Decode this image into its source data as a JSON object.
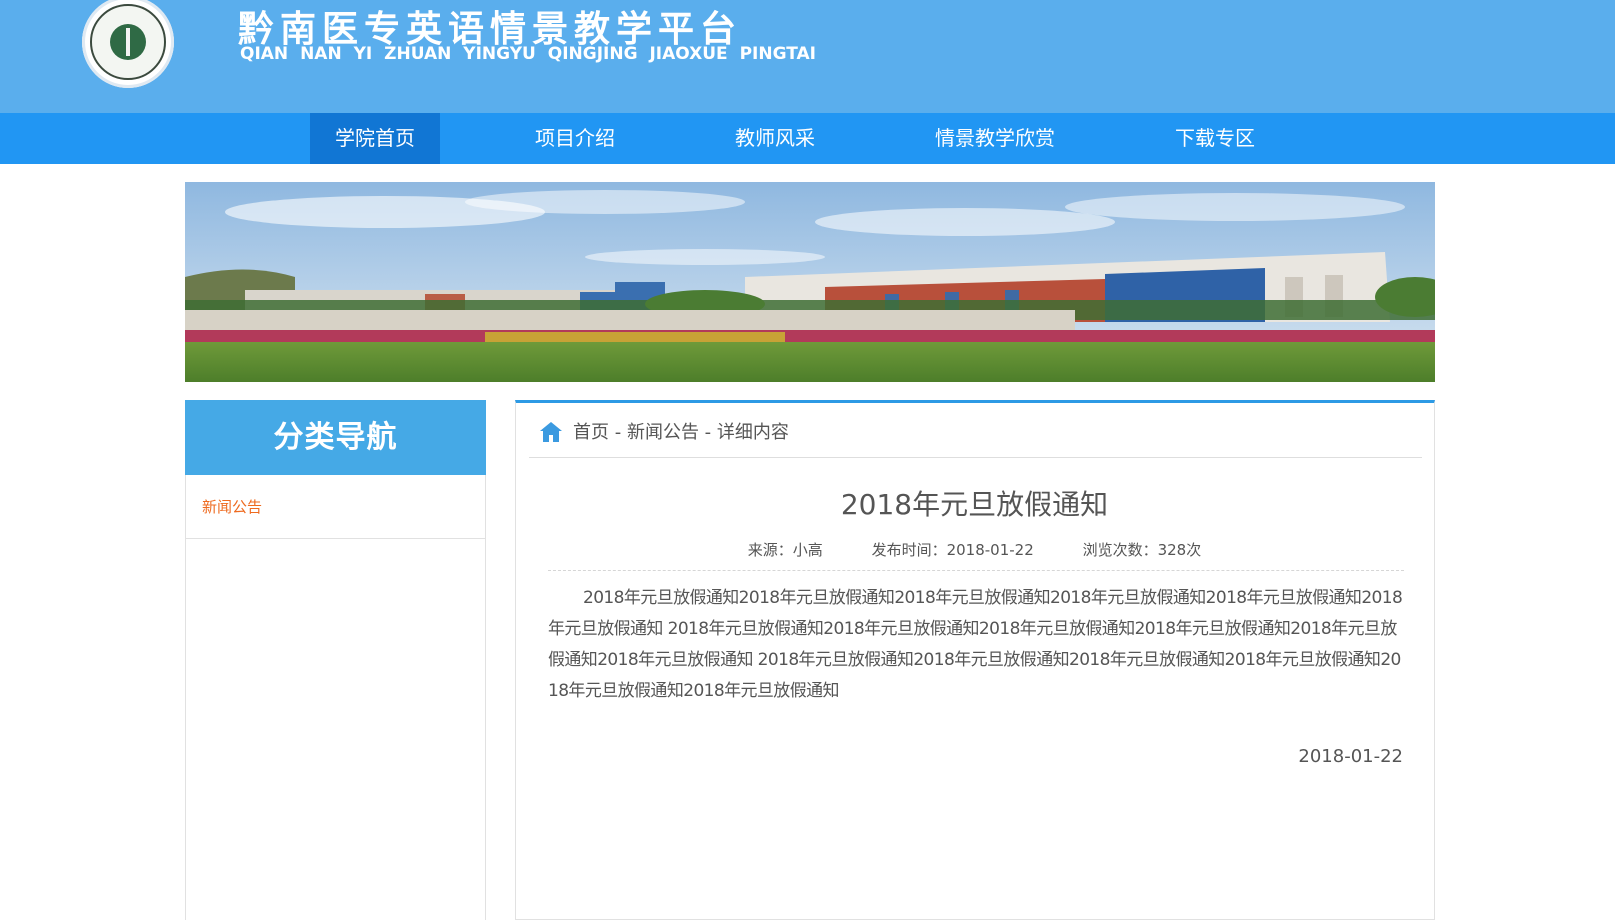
{
  "header": {
    "title": "黔南医专英语情景教学平台",
    "subtitle": "QIAN  NAN  YI ZHUAN  YINGYU  QINGJING   JIAOXUE PINGTAI",
    "logo_icon": "school-emblem-icon"
  },
  "nav": {
    "items": [
      {
        "label": "学院首页",
        "active": true
      },
      {
        "label": "项目介绍",
        "active": false
      },
      {
        "label": "教师风采",
        "active": false
      },
      {
        "label": "情景教学欣赏",
        "active": false
      },
      {
        "label": "下载专区",
        "active": false
      }
    ]
  },
  "banner": {
    "image": "campus-photo"
  },
  "sidebar": {
    "title": "分类导航",
    "items": [
      {
        "label": "新闻公告"
      }
    ]
  },
  "breadcrumb": {
    "icon": "home-icon",
    "text": "首页 - 新闻公告 - 详细内容"
  },
  "article": {
    "title": "2018年元旦放假通知",
    "source": "来源：小高",
    "published": "发布时间：2018-01-22",
    "views": "浏览次数：328次",
    "body": "2018年元旦放假通知2018年元旦放假通知2018年元旦放假通知2018年元旦放假通知2018年元旦放假通知2018年元旦放假通知 2018年元旦放假通知2018年元旦放假通知2018年元旦放假通知2018年元旦放假通知2018年元旦放假通知2018年元旦放假通知 2018年元旦放假通知2018年元旦放假通知2018年元旦放假通知2018年元旦放假通知2018年元旦放假通知2018年元旦放假通知",
    "date": "2018-01-22"
  },
  "colors": {
    "header_bg": "#5aaeed",
    "nav_bg": "#2196f3",
    "nav_active": "#1176d4",
    "sidebar_title_bg": "#45a9e6",
    "link_orange": "#ee6a1f",
    "main_top_border": "#2d9ae5"
  }
}
